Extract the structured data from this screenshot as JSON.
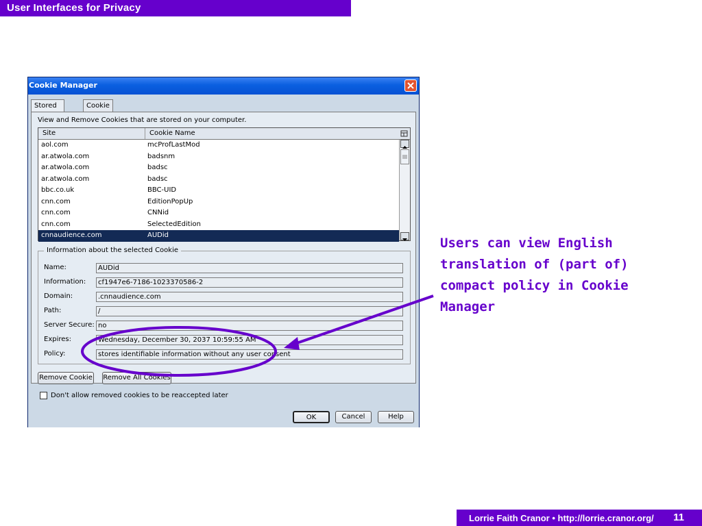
{
  "slide": {
    "header": "User Interfaces for Privacy",
    "footer_author": "Lorrie Faith Cranor  •  http://lorrie.cranor.org/",
    "page_number": "11",
    "callout": "Users can view English translation of (part of) compact policy in Cookie Manager",
    "accent_color": "#6600cc"
  },
  "window": {
    "title": "Cookie Manager",
    "tabs": [
      {
        "label": "Stored Cookies",
        "active": true
      },
      {
        "label": "Cookie Sites",
        "active": false
      }
    ],
    "instruction": "View and Remove Cookies that are stored on your computer.",
    "table": {
      "columns": [
        "Site",
        "Cookie Name"
      ],
      "rows": [
        {
          "site": "aol.com",
          "cookie": "mcProfLastMod"
        },
        {
          "site": "ar.atwola.com",
          "cookie": "badsnm"
        },
        {
          "site": "ar.atwola.com",
          "cookie": "badsc"
        },
        {
          "site": "ar.atwola.com",
          "cookie": "badsc"
        },
        {
          "site": "bbc.co.uk",
          "cookie": "BBC-UID"
        },
        {
          "site": "cnn.com",
          "cookie": "EditionPopUp"
        },
        {
          "site": "cnn.com",
          "cookie": "CNNid"
        },
        {
          "site": "cnn.com",
          "cookie": "SelectedEdition"
        },
        {
          "site": "cnnaudience.com",
          "cookie": "AUDid",
          "selected": true
        }
      ]
    },
    "info": {
      "legend": "Information about the selected Cookie",
      "fields": [
        {
          "label": "Name:",
          "value": "AUDid"
        },
        {
          "label": "Information:",
          "value": "cf1947e6-7186-1023370586-2"
        },
        {
          "label": "Domain:",
          "value": ".cnnaudience.com"
        },
        {
          "label": "Path:",
          "value": "/"
        },
        {
          "label": "Server Secure:",
          "value": "no"
        },
        {
          "label": "Expires:",
          "value": "Wednesday, December 30, 2037 10:59:55 AM"
        },
        {
          "label": "Policy:",
          "value": "stores identifiable information without any user consent"
        }
      ]
    },
    "remove_cookie_label": "Remove Cookie",
    "remove_all_label": "Remove All Cookies",
    "dont_allow_label": "Don't allow removed cookies to be reaccepted later",
    "dont_allow_checked": false,
    "ok_label": "OK",
    "cancel_label": "Cancel",
    "help_label": "Help"
  }
}
